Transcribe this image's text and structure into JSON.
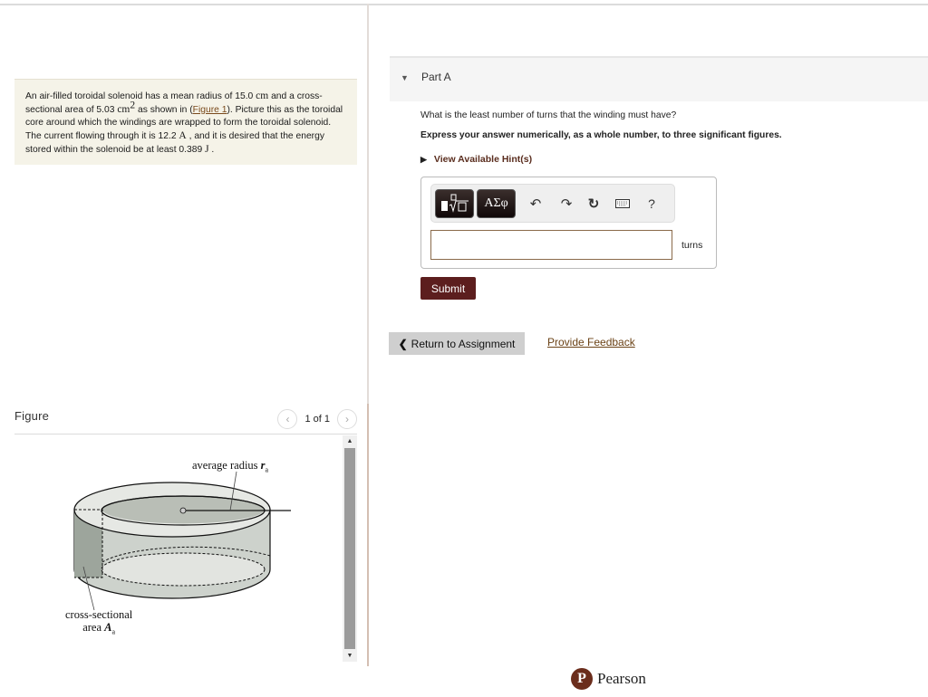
{
  "problem": {
    "text_1": "An air-filled toroidal solenoid has a mean radius of 15.0 ",
    "unit_radius": "cm",
    "text_2": " and a cross-sectional area of 5.03 ",
    "unit_area": "cm",
    "unit_area_exp": "2",
    "text_3": " as shown in (",
    "figure_link": "Figure 1",
    "text_4": "). Picture this as the toroidal core around which the windings are wrapped to form the toroidal solenoid. The current flowing through it is 12.2 ",
    "unit_current": "A",
    "text_5": " , and it is desired that the energy stored within the solenoid be at least 0.389 ",
    "unit_energy": "J",
    "text_6": " ."
  },
  "figure": {
    "title": "Figure",
    "pager": "1 of 1",
    "prev_icon": "‹",
    "next_icon": "›",
    "label_radius": "average radius ",
    "label_radius_symbol": "r",
    "label_radius_sub": "a",
    "label_area_1": "cross-sectional",
    "label_area_2": "area ",
    "label_area_symbol": "A",
    "label_area_sub": "a"
  },
  "part": {
    "title": "Part A",
    "question": "What is the least number of turns that the winding must have?",
    "instructions": "Express your answer numerically, as a whole number, to three significant figures.",
    "hints_label": "View Available Hint(s)"
  },
  "answer": {
    "toolbar": {
      "symbols_label": "ΑΣφ",
      "undo": "↶",
      "redo": "↷",
      "reset": "↻",
      "help": "?"
    },
    "input_value": "",
    "unit": "turns",
    "submit_label": "Submit"
  },
  "footer": {
    "return_label": "Return to Assignment",
    "feedback_label": "Provide Feedback",
    "brand": "Pearson",
    "brand_logo_letter": "P"
  },
  "colors": {
    "submit_bg": "#5c1e1e",
    "link": "#6b4216",
    "problem_bg": "#f5f3e8"
  }
}
